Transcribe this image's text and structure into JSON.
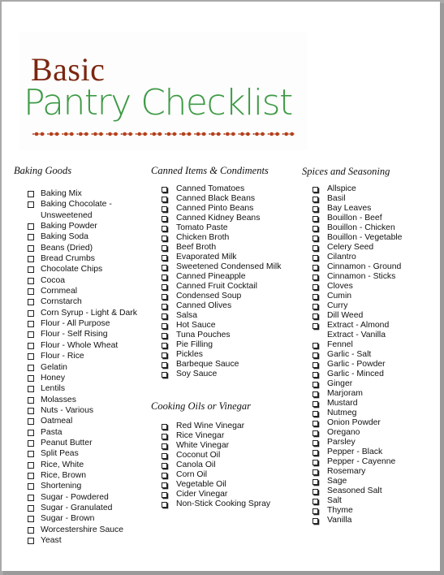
{
  "header": {
    "title_line1": "Basic",
    "title_line2": "Pantry Checklist",
    "colors": {
      "title_line1": "#7b2610",
      "title_line2": "#3d9a45",
      "divider": "#b5401c"
    }
  },
  "sections": {
    "baking": {
      "heading": "Baking Goods",
      "checkbox_icon": "empty-square",
      "items": [
        {
          "label": "Baking Mix",
          "checkbox": true
        },
        {
          "label": "Baking Chocolate -",
          "checkbox": true
        },
        {
          "label": "Unsweetened",
          "checkbox": false
        },
        {
          "label": "Baking Powder",
          "checkbox": true
        },
        {
          "label": "Baking Soda",
          "checkbox": true
        },
        {
          "label": "Beans (Dried)",
          "checkbox": true
        },
        {
          "label": "Bread Crumbs",
          "checkbox": true
        },
        {
          "label": "Chocolate Chips",
          "checkbox": true
        },
        {
          "label": "Cocoa",
          "checkbox": true
        },
        {
          "label": "Cornmeal",
          "checkbox": true
        },
        {
          "label": "Cornstarch",
          "checkbox": true
        },
        {
          "label": "Corn Syrup - Light & Dark",
          "checkbox": true
        },
        {
          "label": "Flour - All Purpose",
          "checkbox": true
        },
        {
          "label": "Flour - Self Rising",
          "checkbox": true
        },
        {
          "label": "Flour - Whole Wheat",
          "checkbox": true
        },
        {
          "label": "Flour - Rice",
          "checkbox": true
        },
        {
          "label": "Gelatin",
          "checkbox": true
        },
        {
          "label": "Honey",
          "checkbox": true
        },
        {
          "label": "Lentils",
          "checkbox": true
        },
        {
          "label": "Molasses",
          "checkbox": true
        },
        {
          "label": "Nuts - Various",
          "checkbox": true
        },
        {
          "label": "Oatmeal",
          "checkbox": true
        },
        {
          "label": "Pasta",
          "checkbox": true
        },
        {
          "label": "Peanut Butter",
          "checkbox": true
        },
        {
          "label": "Split Peas",
          "checkbox": true
        },
        {
          "label": "Rice, White",
          "checkbox": true
        },
        {
          "label": "Rice, Brown",
          "checkbox": true
        },
        {
          "label": "Shortening",
          "checkbox": true
        },
        {
          "label": "Sugar - Powdered",
          "checkbox": true
        },
        {
          "label": "Sugar - Granulated",
          "checkbox": true
        },
        {
          "label": "Sugar - Brown",
          "checkbox": true
        },
        {
          "label": "Worcestershire Sauce",
          "checkbox": true
        },
        {
          "label": "Yeast",
          "checkbox": true
        }
      ]
    },
    "canned": {
      "heading": "Canned Items & Condiments",
      "checkbox_icon": "shadowed-square",
      "items": [
        {
          "label": "Canned Tomatoes",
          "checkbox": true
        },
        {
          "label": "Canned Black Beans",
          "checkbox": true
        },
        {
          "label": "Canned Pinto Beans",
          "checkbox": true
        },
        {
          "label": "Canned Kidney Beans",
          "checkbox": true
        },
        {
          "label": "Tomato Paste",
          "checkbox": true
        },
        {
          "label": "Chicken Broth",
          "checkbox": true
        },
        {
          "label": "Beef Broth",
          "checkbox": true
        },
        {
          "label": "Evaporated Milk",
          "checkbox": true
        },
        {
          "label": "Sweetened Condensed Milk",
          "checkbox": true
        },
        {
          "label": "Canned Pineapple",
          "checkbox": true
        },
        {
          "label": "Canned Fruit Cocktail",
          "checkbox": true
        },
        {
          "label": "Condensed Soup",
          "checkbox": true
        },
        {
          "label": "Canned Olives",
          "checkbox": true
        },
        {
          "label": "Salsa",
          "checkbox": true
        },
        {
          "label": "Hot Sauce",
          "checkbox": true
        },
        {
          "label": "Tuna Pouches",
          "checkbox": true
        },
        {
          "label": "Pie Filling",
          "checkbox": true
        },
        {
          "label": "Pickles",
          "checkbox": true
        },
        {
          "label": "Barbeque Sauce",
          "checkbox": true
        },
        {
          "label": "Soy Sauce",
          "checkbox": true
        }
      ]
    },
    "oils": {
      "heading": "Cooking Oils or Vinegar",
      "checkbox_icon": "shadowed-square",
      "items": [
        {
          "label": "Red Wine Vinegar",
          "checkbox": true
        },
        {
          "label": "Rice Vinegar",
          "checkbox": true
        },
        {
          "label": "White Vinegar",
          "checkbox": true
        },
        {
          "label": "Coconut Oil",
          "checkbox": true
        },
        {
          "label": "Canola Oil",
          "checkbox": true
        },
        {
          "label": "Corn Oil",
          "checkbox": true
        },
        {
          "label": "Vegetable Oil",
          "checkbox": true
        },
        {
          "label": "Cider Vinegar",
          "checkbox": true
        },
        {
          "label": "Non-Stick Cooking Spray",
          "checkbox": true
        }
      ]
    },
    "spices": {
      "heading": "Spices and Seasoning",
      "checkbox_icon": "shadowed-square",
      "items": [
        {
          "label": "Allspice",
          "checkbox": true
        },
        {
          "label": "Basil",
          "checkbox": true
        },
        {
          "label": "Bay Leaves",
          "checkbox": true
        },
        {
          "label": "Bouillon - Beef",
          "checkbox": true
        },
        {
          "label": "Bouillon - Chicken",
          "checkbox": true
        },
        {
          "label": "Bouillon - Vegetable",
          "checkbox": true
        },
        {
          "label": "Celery Seed",
          "checkbox": true
        },
        {
          "label": "Cilantro",
          "checkbox": true
        },
        {
          "label": "Cinnamon - Ground",
          "checkbox": true
        },
        {
          "label": "Cinnamon - Sticks",
          "checkbox": true
        },
        {
          "label": "Cloves",
          "checkbox": true
        },
        {
          "label": "Cumin",
          "checkbox": true
        },
        {
          "label": "Curry",
          "checkbox": true
        },
        {
          "label": "Dill Weed",
          "checkbox": true
        },
        {
          "label": "Extract - Almond",
          "checkbox": true
        },
        {
          "label": "Extract - Vanilla",
          "checkbox": false
        },
        {
          "label": "Fennel",
          "checkbox": true
        },
        {
          "label": "Garlic - Salt",
          "checkbox": true
        },
        {
          "label": "Garlic - Powder",
          "checkbox": true
        },
        {
          "label": "Garlic - Minced",
          "checkbox": true
        },
        {
          "label": "Ginger",
          "checkbox": true
        },
        {
          "label": "Marjoram",
          "checkbox": true
        },
        {
          "label": "Mustard",
          "checkbox": true
        },
        {
          "label": "Nutmeg",
          "checkbox": true
        },
        {
          "label": "Onion Powder",
          "checkbox": true
        },
        {
          "label": "Oregano",
          "checkbox": true
        },
        {
          "label": "Parsley",
          "checkbox": true
        },
        {
          "label": "Pepper - Black",
          "checkbox": true
        },
        {
          "label": "Pepper - Cayenne",
          "checkbox": true
        },
        {
          "label": "Rosemary",
          "checkbox": true
        },
        {
          "label": "Sage",
          "checkbox": true
        },
        {
          "label": "Seasoned Salt",
          "checkbox": true
        },
        {
          "label": "Salt",
          "checkbox": true
        },
        {
          "label": "Thyme",
          "checkbox": true
        },
        {
          "label": "Vanilla",
          "checkbox": true
        }
      ]
    }
  }
}
